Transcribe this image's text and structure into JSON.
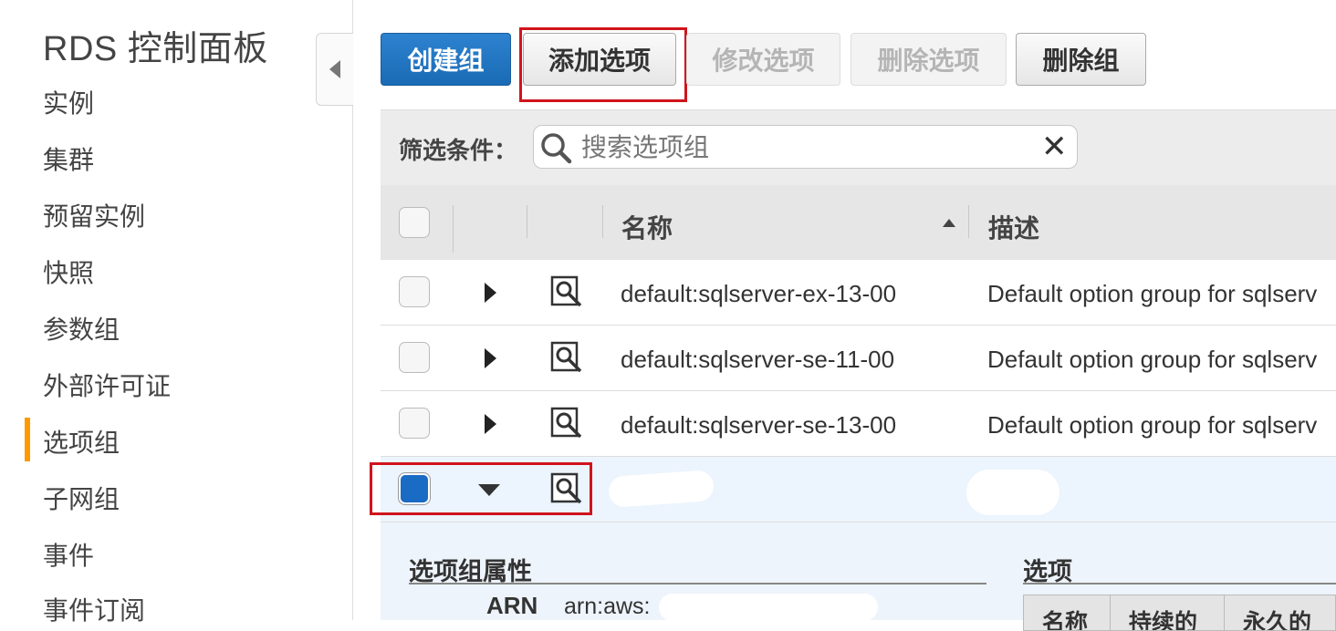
{
  "sidebar": {
    "title": "RDS 控制面板",
    "items": [
      {
        "label": "实例"
      },
      {
        "label": "集群"
      },
      {
        "label": "预留实例"
      },
      {
        "label": "快照"
      },
      {
        "label": "参数组"
      },
      {
        "label": "外部许可证"
      },
      {
        "label": "选项组"
      },
      {
        "label": "子网组"
      },
      {
        "label": "事件"
      },
      {
        "label": "事件订阅"
      }
    ],
    "active_item": "选项组"
  },
  "toolbar": {
    "create_group": "创建组",
    "add_option": "添加选项",
    "modify_option": "修改选项",
    "delete_option": "删除选项",
    "delete_group": "删除组"
  },
  "filter": {
    "label": "筛选条件：",
    "placeholder": "搜索选项组"
  },
  "table": {
    "columns": {
      "name": "名称",
      "description": "描述"
    },
    "sort": "ascending",
    "rows": [
      {
        "name": "default:sqlserver-ex-13-00",
        "description": "Default option group for sqlserv"
      },
      {
        "name": "default:sqlserver-se-11-00",
        "description": "Default option group for sqlserv"
      },
      {
        "name": "default:sqlserver-se-13-00",
        "description": "Default option group for sqlserv"
      },
      {
        "name": "",
        "description": "",
        "selected": true,
        "expanded": true
      }
    ]
  },
  "detail": {
    "properties_title": "选项组属性",
    "arn_label": "ARN",
    "arn_value": "arn:aws:",
    "options_title": "选项",
    "options_columns": [
      "名称",
      "持续的",
      "永久的"
    ]
  },
  "colors": {
    "accent": "#f90",
    "primary": "#1a6bb5",
    "highlight": "#d0141c",
    "selected_row": "#ecf4fd"
  }
}
